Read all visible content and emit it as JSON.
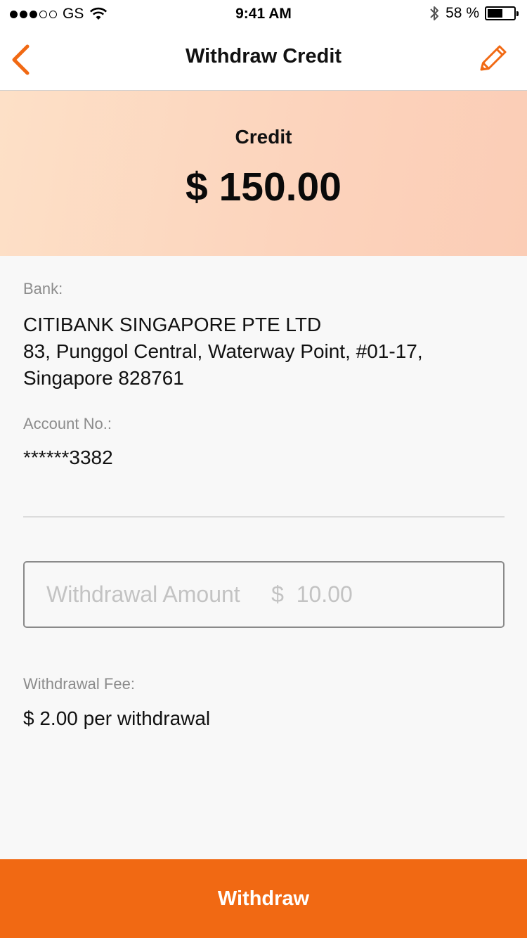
{
  "status_bar": {
    "carrier": "GS",
    "time": "9:41 AM",
    "battery_text": "58 %",
    "battery_level": 0.58
  },
  "nav": {
    "title": "Withdraw Credit",
    "back_icon": "chevron-left-icon",
    "edit_icon": "pencil-icon"
  },
  "credit": {
    "label": "Credit",
    "amount": "$ 150.00"
  },
  "bank": {
    "label": "Bank:",
    "name": "CITIBANK SINGAPORE PTE LTD",
    "address_line1": "83, Punggol Central, Waterway Point, #01-17,",
    "address_line2": "Singapore 828761"
  },
  "account": {
    "label": "Account No.:",
    "value": "******3382"
  },
  "withdrawal_input": {
    "placeholder": "Withdrawal Amount     $  10.00",
    "value": ""
  },
  "fee": {
    "label": "Withdrawal Fee:",
    "value": "$ 2.00 per withdrawal"
  },
  "actions": {
    "withdraw_label": "Withdraw"
  },
  "colors": {
    "accent": "#f16913",
    "banner_start": "#fde0c7",
    "banner_end": "#fbcdb6"
  }
}
